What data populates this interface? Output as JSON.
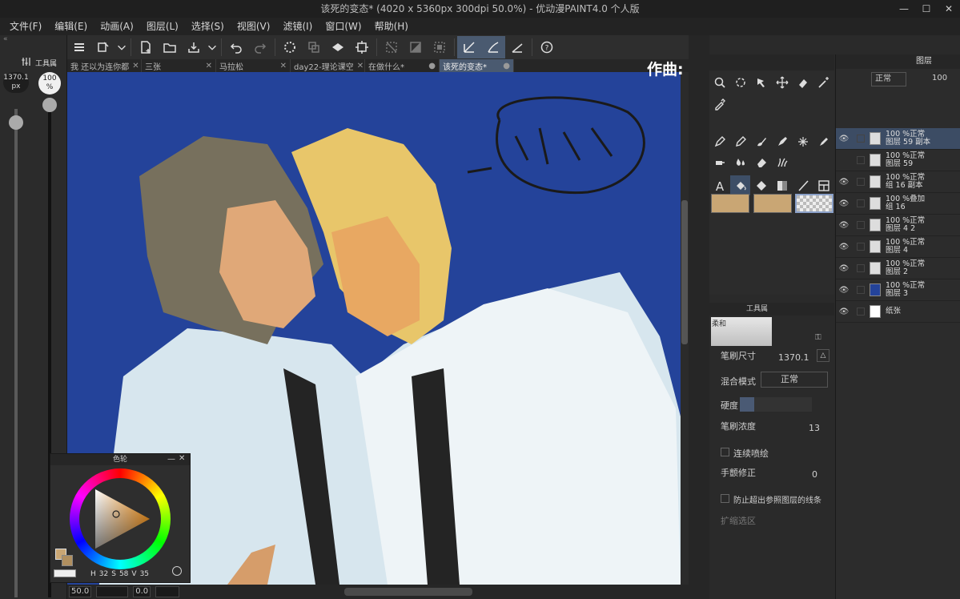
{
  "window": {
    "title": "该死的变态* (4020 x 5360px 300dpi 50.0%) - 优动漫PAINT4.0 个人版",
    "min": "—",
    "max": "☐",
    "close": "✕"
  },
  "menu": [
    "文件(F)",
    "编辑(E)",
    "动画(A)",
    "图层(L)",
    "选择(S)",
    "视图(V)",
    "滤镜(I)",
    "窗口(W)",
    "帮助(H)"
  ],
  "left": {
    "brush_size": "1370.1",
    "brush_unit": "px",
    "opacity": "100",
    "opacity_unit": "%",
    "panel_tab": "工具属"
  },
  "doc_tabs": [
    {
      "label": "我 还以为连你都",
      "active": false
    },
    {
      "label": "三张",
      "active": false
    },
    {
      "label": "马拉松",
      "active": false
    },
    {
      "label": "day22-理论课空",
      "active": false
    },
    {
      "label": "在做什么*",
      "active": false
    },
    {
      "label": "该死的变态*",
      "active": true
    }
  ],
  "watermark": "作曲: Natalie R Lu",
  "canvas": {
    "bg": "#24439a"
  },
  "color_wheel": {
    "title": "色轮",
    "h": "32",
    "s": "58",
    "v": "35",
    "h_label": "H",
    "s_label": "S",
    "v_label": "V",
    "main_color": "#c9a674"
  },
  "tool_panel": {
    "swatch_colors": [
      "#c9a674",
      "#c9a674"
    ]
  },
  "props": {
    "tabs": [
      "工具属"
    ],
    "brush_name": "柔和",
    "brush_size_label": "笔刷尺寸",
    "brush_size_value": "1370.1",
    "blend_label": "混合模式",
    "blend_value": "正常",
    "hardness_label": "硬度",
    "density_label": "笔刷浓度",
    "density_value": "13",
    "continuous_label": "连续喷绘",
    "stabilize_label": "手颤修正",
    "stabilize_value": "0",
    "no_exceed_label": "防止超出参照图层的线条",
    "expand_label": "扩缩选区"
  },
  "layers": {
    "tab_label": "图层",
    "blend": "正常",
    "opacity": "100",
    "items": [
      {
        "line1": "100 %正常",
        "line2": "图层 59 副本",
        "sel": true
      },
      {
        "line1": "100 %正常",
        "line2": "图层 59",
        "sel": false
      },
      {
        "line1": "100 %正常",
        "line2": "组 16 副本",
        "sel": false
      },
      {
        "line1": "100 %叠加",
        "line2": "组 16",
        "sel": false
      },
      {
        "line1": "100 %正常",
        "line2": "图层 4 2",
        "sel": false
      },
      {
        "line1": "100 %正常",
        "line2": "图层 4",
        "sel": false
      },
      {
        "line1": "100 %正常",
        "line2": "图层 2",
        "sel": false
      },
      {
        "line1": "100 %正常",
        "line2": "图层 3",
        "sel": false
      },
      {
        "line1": "",
        "line2": "纸张",
        "sel": false
      }
    ]
  },
  "status": {
    "zoom": "50.0",
    "angle": "0.0"
  }
}
